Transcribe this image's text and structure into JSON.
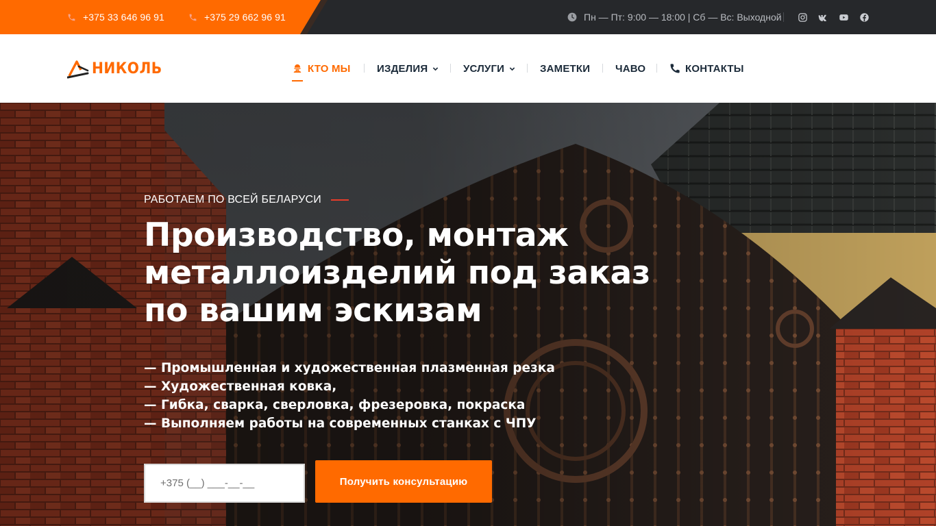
{
  "colors": {
    "accent": "#ff6a00",
    "topbar": "#26282b",
    "nav_text": "#1c2b3a",
    "eyebrow_line": "#e83c2a"
  },
  "topbar": {
    "phones": [
      "+375 33 646 96 91",
      "+375 29 662 96 91"
    ],
    "hours": "Пн — Пт: 9:00 — 18:00 | Сб — Вс: Выходной",
    "socials": [
      "instagram-icon",
      "vk-icon",
      "youtube-icon",
      "facebook-icon"
    ]
  },
  "header": {
    "logo_text": "НИКОЛЬ",
    "nav": [
      {
        "label": "КТО МЫ",
        "icon": "worker-icon",
        "active": true
      },
      {
        "label": "ИЗДЕЛИЯ",
        "dropdown": true
      },
      {
        "label": "УСЛУГИ",
        "dropdown": true
      },
      {
        "label": "ЗАМЕТКИ"
      },
      {
        "label": "ЧАВО"
      },
      {
        "label": "КОНТАКТЫ",
        "icon": "phone-icon"
      }
    ]
  },
  "hero": {
    "eyebrow": "РАБОТАЕМ ПО ВСЕЙ БЕЛАРУСИ",
    "headline": [
      "Производство, монтаж",
      "металлоизделий под заказ",
      "по вашим эскизам"
    ],
    "bullets": [
      "— Промышленная и художественная плазменная резка",
      "— Художественная ковка,",
      "— Гибка, сварка, сверловка, фрезеровка, покраска",
      "— Выполняем работы на современных станках с ЧПУ"
    ],
    "phone_placeholder": "+375 (__) ___-__-__",
    "cta_label": "Получить консультацию"
  }
}
